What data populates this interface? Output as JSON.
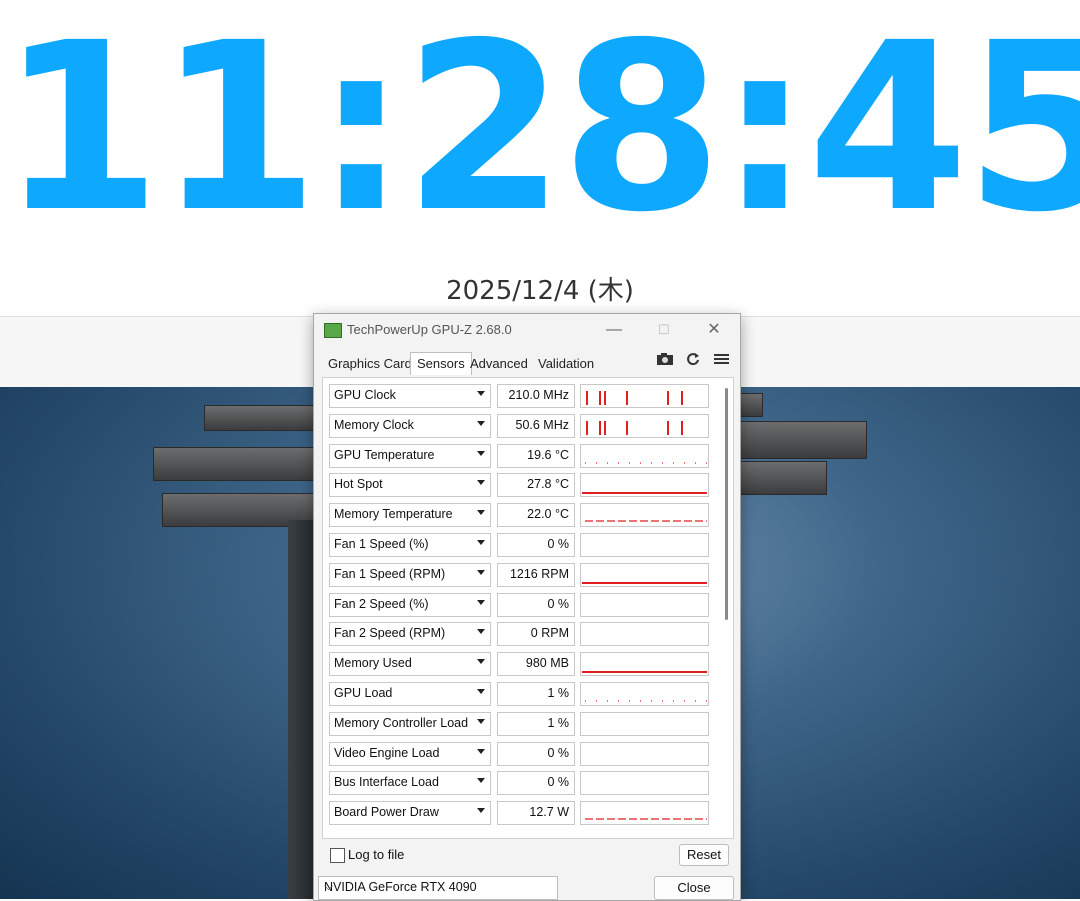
{
  "clock": {
    "time": "11:28:45",
    "date": "2025/12/4 (木)",
    "accent": "#0ea8ff"
  },
  "window": {
    "title": "TechPowerUp GPU-Z 2.68.0",
    "controls": {
      "minimize": "—",
      "maximize": "☐",
      "close": "✕"
    },
    "tabs": [
      "Graphics Card",
      "Sensors",
      "Advanced",
      "Validation"
    ],
    "active_tab": "Sensors",
    "tools": {
      "camera": "camera-icon",
      "refresh": "refresh-icon",
      "menu": "menu-icon"
    },
    "sensors": [
      {
        "name": "GPU Clock",
        "value": "210.0 MHz",
        "graph": "spikes"
      },
      {
        "name": "Memory Clock",
        "value": "50.6 MHz",
        "graph": "spikes"
      },
      {
        "name": "GPU Temperature",
        "value": "19.6 °C",
        "graph": "dots"
      },
      {
        "name": "Hot Spot",
        "value": "27.8 °C",
        "graph": "line"
      },
      {
        "name": "Memory Temperature",
        "value": "22.0 °C",
        "graph": "dashes"
      },
      {
        "name": "Fan 1 Speed (%)",
        "value": "0 %",
        "graph": "none"
      },
      {
        "name": "Fan 1 Speed (RPM)",
        "value": "1216 RPM",
        "graph": "line"
      },
      {
        "name": "Fan 2 Speed (%)",
        "value": "0 %",
        "graph": "none"
      },
      {
        "name": "Fan 2 Speed (RPM)",
        "value": "0 RPM",
        "graph": "none"
      },
      {
        "name": "Memory Used",
        "value": "980 MB",
        "graph": "line"
      },
      {
        "name": "GPU Load",
        "value": "1 %",
        "graph": "dots"
      },
      {
        "name": "Memory Controller Load",
        "value": "1 %",
        "graph": "none"
      },
      {
        "name": "Video Engine Load",
        "value": "0 %",
        "graph": "none"
      },
      {
        "name": "Bus Interface Load",
        "value": "0 %",
        "graph": "none"
      },
      {
        "name": "Board Power Draw",
        "value": "12.7 W",
        "graph": "dashes"
      }
    ],
    "log_to_file": "Log to file",
    "reset": "Reset",
    "device": "NVIDIA GeForce RTX 4090",
    "close_button": "Close",
    "graph_color": "#e02020"
  }
}
